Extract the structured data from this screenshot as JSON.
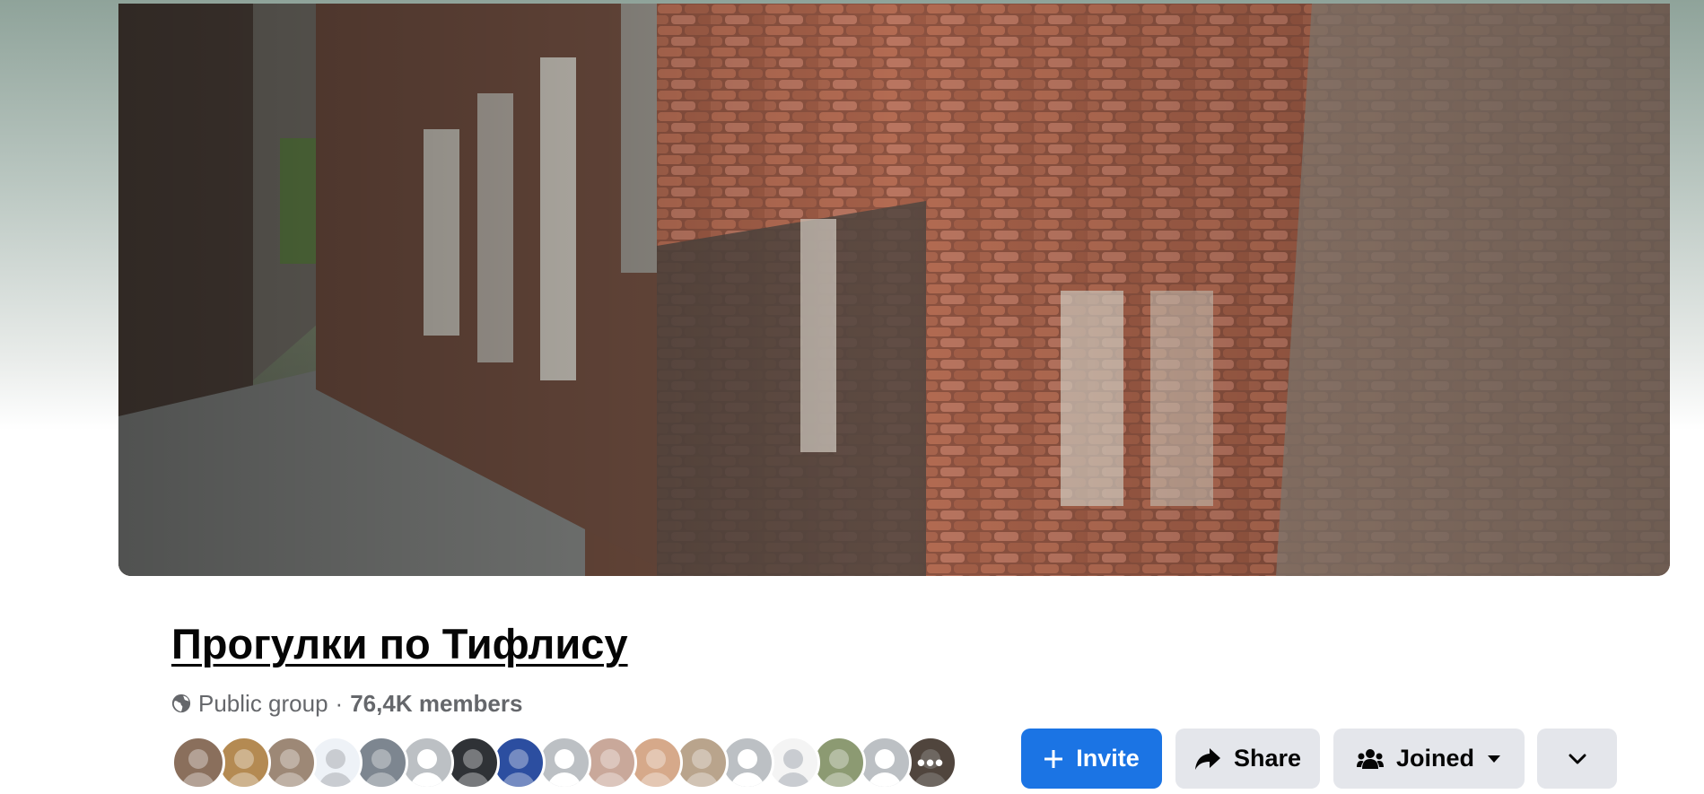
{
  "group": {
    "name": "Прогулки по Тифлису",
    "privacy": "Public group",
    "separator": "·",
    "members": "76,4K members"
  },
  "cover": {
    "description": "Cover photo"
  },
  "member_avatars": [
    {
      "color": "#8a6f5c"
    },
    {
      "color": "#b48a52"
    },
    {
      "color": "#9d8876"
    },
    {
      "color": "#eef2f7"
    },
    {
      "color": "#7d8690"
    },
    {
      "color": "#bcc0c4"
    },
    {
      "color": "#2f3236"
    },
    {
      "color": "#2c4ea0"
    },
    {
      "color": "#bcc0c4"
    },
    {
      "color": "#c9a89a"
    },
    {
      "color": "#d6a98a"
    },
    {
      "color": "#b9a48c"
    },
    {
      "color": "#bcc0c4"
    },
    {
      "color": "#f4f4f4"
    },
    {
      "color": "#8c9a72"
    },
    {
      "color": "#bcc0c4"
    },
    {
      "color": "#7b6a5e"
    }
  ],
  "actions": {
    "invite": "Invite",
    "share": "Share",
    "joined": "Joined"
  },
  "colors": {
    "primary": "#1b74e4",
    "secondary_button": "#e4e6eb",
    "text_primary": "#050505",
    "text_secondary": "#65676b"
  }
}
